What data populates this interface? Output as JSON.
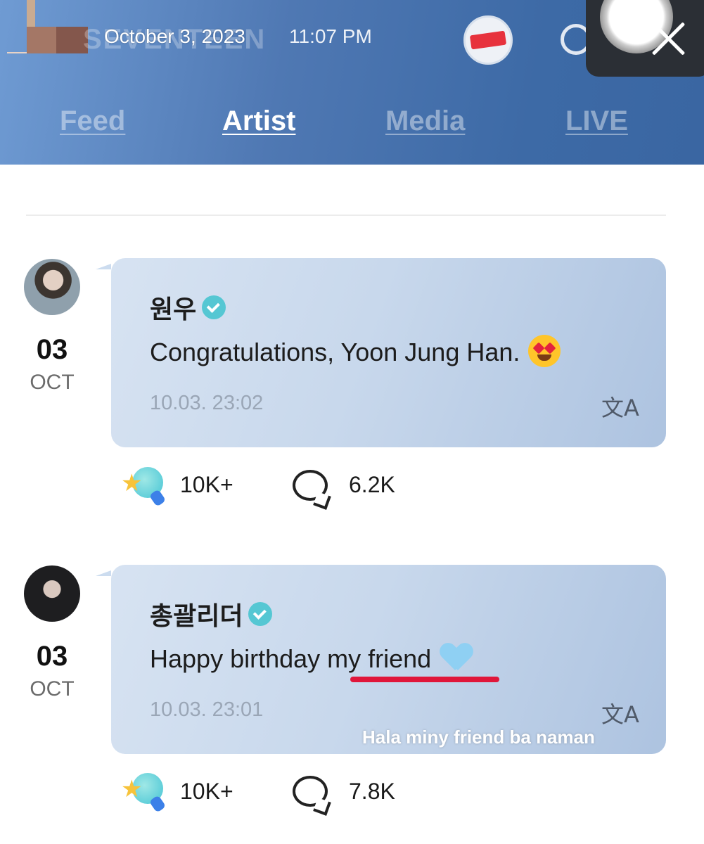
{
  "status_bar": {
    "date": "October 3, 2023",
    "time": "11:07 PM",
    "brand_text": "SEVENTEEN"
  },
  "tabs": [
    {
      "label": "Feed",
      "active": false
    },
    {
      "label": "Artist",
      "active": true
    },
    {
      "label": "Media",
      "active": false
    },
    {
      "label": "LIVE",
      "active": false
    }
  ],
  "icons": {
    "logo": "seventeen-logo-icon",
    "search": "search-icon",
    "close": "close-icon",
    "verified": "verified-badge-icon",
    "translate": "translate-icon",
    "reaction": "reaction-icon",
    "comment": "comment-icon"
  },
  "colors": {
    "header_gradient_start": "#6f9bd3",
    "header_gradient_end": "#3a66a2",
    "bubble": "#c8d8ec",
    "verified": "#55c7d3",
    "highlight_underline": "#e0163a"
  },
  "posts": [
    {
      "day": "03",
      "month": "OCT",
      "author": "원우",
      "message": "Congratulations, Yoon Jung Han.",
      "emoji": "smiling-face-with-heart-eyes",
      "timestamp": "10.03. 23:02",
      "translate_glyph": "文A",
      "reactions": "10K+",
      "comments": "6.2K"
    },
    {
      "day": "03",
      "month": "OCT",
      "author": "총괄리더",
      "message_plain": "Happy birthday ",
      "message_highlight": "my friend",
      "emoji": "light-blue-heart",
      "timestamp": "10.03. 23:01",
      "translate_glyph": "文A",
      "overlay_caption": "Hala miny friend ba naman",
      "reactions": "10K+",
      "comments": "7.8K"
    }
  ]
}
